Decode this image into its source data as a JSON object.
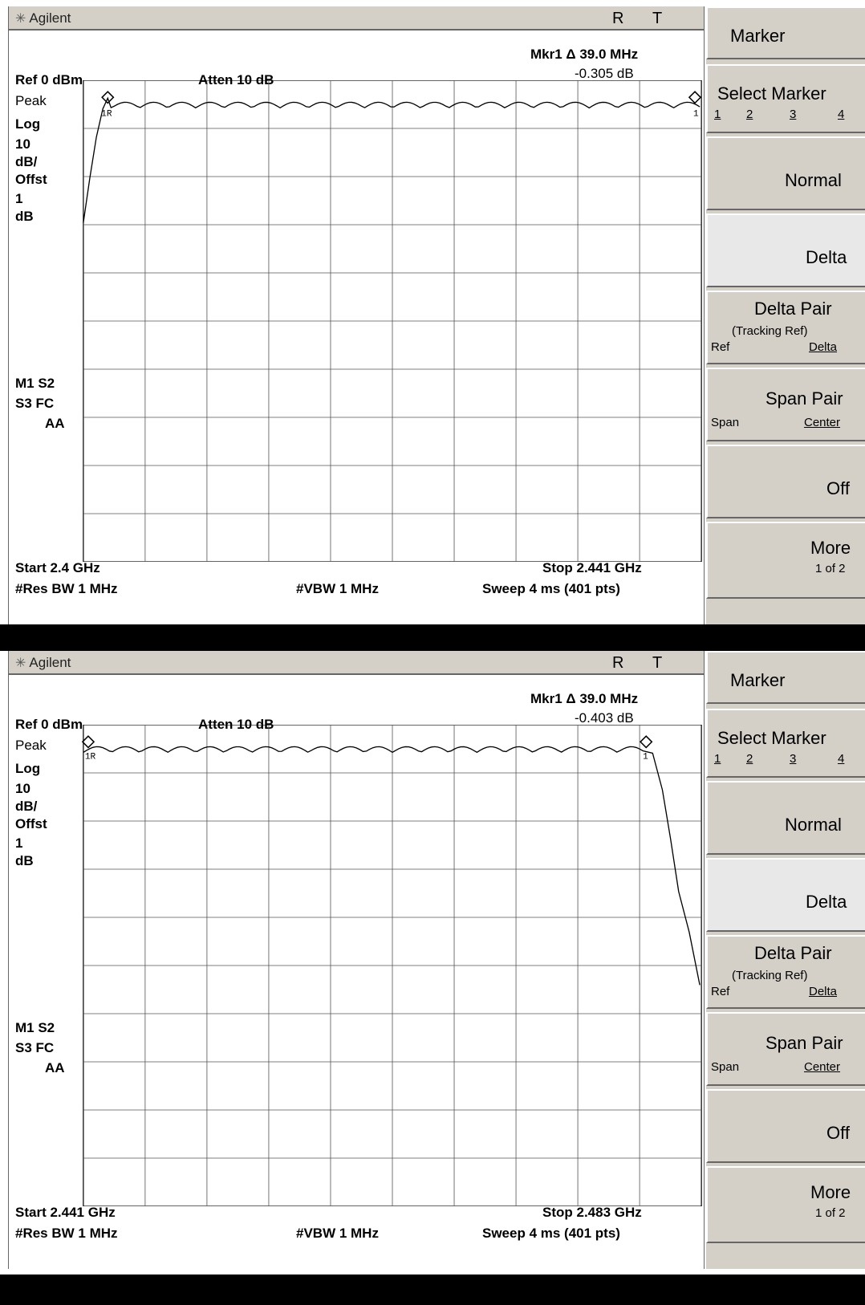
{
  "panels": [
    {
      "brand": "Agilent",
      "status_r": "R",
      "status_t": "T",
      "marker_readout": "Mkr1 Δ 39.0 MHz",
      "marker_value": "-0.305 dB",
      "ref_level": "Ref 0 dBm",
      "atten": "Atten 10 dB",
      "detector": "Peak",
      "scale_lines": [
        "Log",
        "10",
        "dB/",
        "Offst",
        "1",
        "dB"
      ],
      "flags_1": "M1  S2",
      "flags_2": "S3  FC",
      "flags_3": "AA",
      "start": "Start 2.4 GHz",
      "stop": "Stop 2.441 GHz",
      "res_bw": "#Res BW 1 MHz",
      "vbw": "#VBW 1 MHz",
      "sweep": "Sweep 4 ms (401 pts)",
      "marker_ref_tag": "1R",
      "marker_tag": "1"
    },
    {
      "brand": "Agilent",
      "status_r": "R",
      "status_t": "T",
      "marker_readout": "Mkr1 Δ 39.0 MHz",
      "marker_value": "-0.403 dB",
      "ref_level": "Ref 0 dBm",
      "atten": "Atten 10 dB",
      "detector": "Peak",
      "scale_lines": [
        "Log",
        "10",
        "dB/",
        "Offst",
        "1",
        "dB"
      ],
      "flags_1": "M1  S2",
      "flags_2": "S3  FC",
      "flags_3": "AA",
      "start": "Start 2.441 GHz",
      "stop": "Stop 2.483 GHz",
      "res_bw": "#Res BW 1 MHz",
      "vbw": "#VBW 1 MHz",
      "sweep": "Sweep 4 ms (401 pts)",
      "marker_ref_tag": "1R",
      "marker_tag": "1"
    }
  ],
  "softkeys": {
    "menu_title": "Marker",
    "select_marker": "Select Marker",
    "marker_numbers": [
      "1",
      "2",
      "3",
      "4"
    ],
    "normal": "Normal",
    "delta": "Delta",
    "delta_pair": "Delta Pair",
    "tracking_ref": "(Tracking Ref)",
    "ref": "Ref",
    "delta_sub": "Delta",
    "span_pair": "Span Pair",
    "span": "Span",
    "center": "Center",
    "off": "Off",
    "more": "More",
    "page": "1 of 2"
  }
}
